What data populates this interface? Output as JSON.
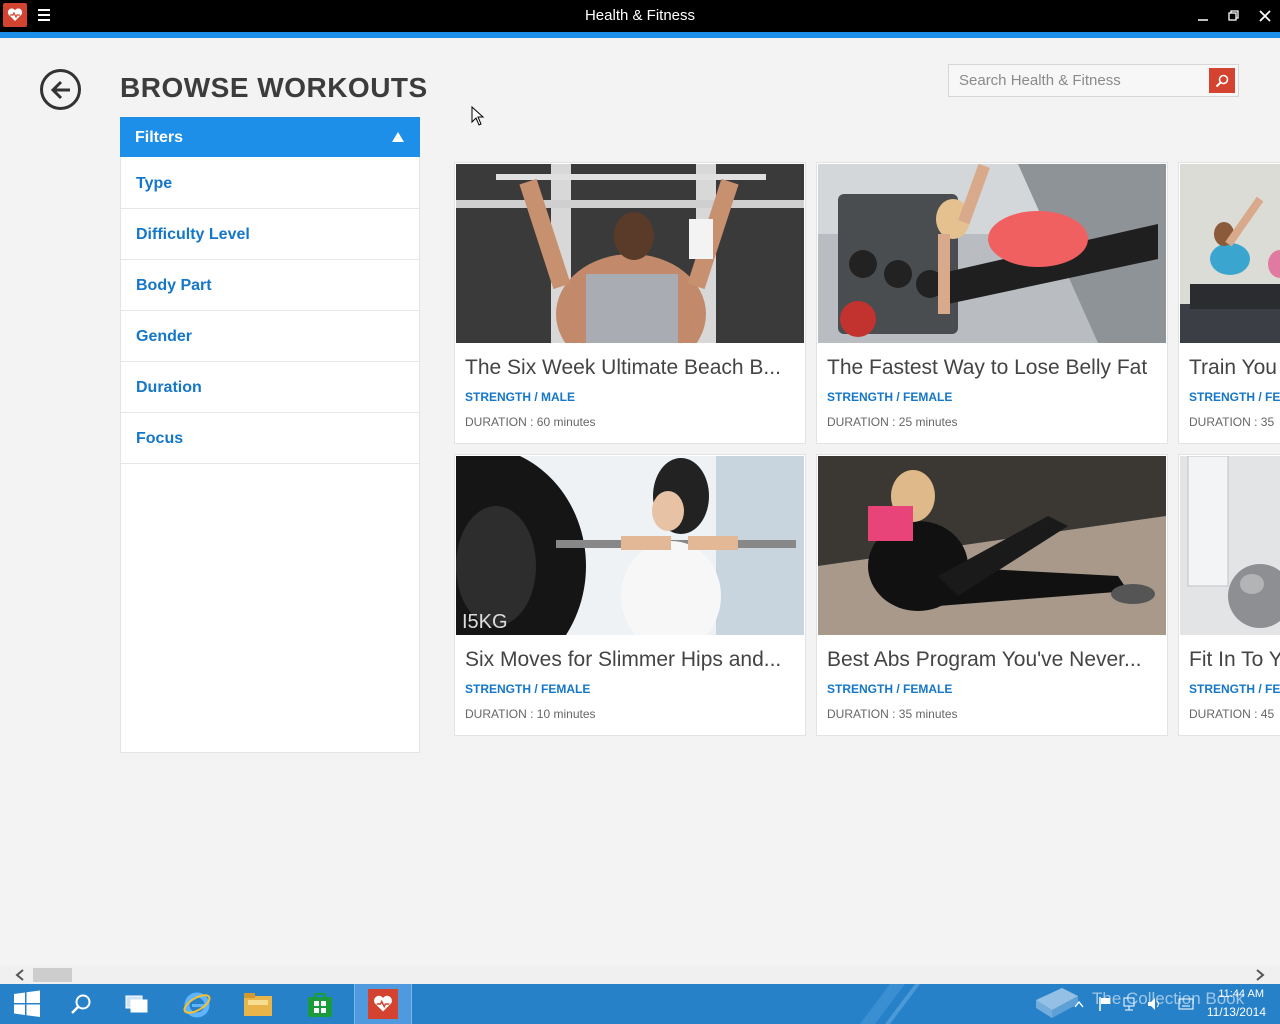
{
  "window": {
    "title": "Health & Fitness"
  },
  "header": {
    "title": "BROWSE WORKOUTS",
    "search_placeholder": "Search Health & Fitness"
  },
  "filters": {
    "heading": "Filters",
    "items": [
      "Type",
      "Difficulty Level",
      "Body Part",
      "Gender",
      "Duration",
      "Focus"
    ]
  },
  "workouts": [
    {
      "title": "The Six Week Ultimate Beach B...",
      "category": "STRENGTH / MALE",
      "duration_label": "DURATION :",
      "duration": "60 minutes"
    },
    {
      "title": "The Fastest Way to Lose Belly Fat",
      "category": "STRENGTH / FEMALE",
      "duration_label": "DURATION :",
      "duration": "25 minutes"
    },
    {
      "title": "Train You",
      "category": "STRENGTH / FE",
      "duration_label": "DURATION :",
      "duration": "35"
    },
    {
      "title": "Six Moves for Slimmer Hips and...",
      "category": "STRENGTH / FEMALE",
      "duration_label": "DURATION :",
      "duration": "10 minutes"
    },
    {
      "title": "Best Abs Program You've Never...",
      "category": "STRENGTH / FEMALE",
      "duration_label": "DURATION :",
      "duration": "35 minutes"
    },
    {
      "title": "Fit In To Y",
      "category": "STRENGTH / FE",
      "duration_label": "DURATION :",
      "duration": "45"
    }
  ],
  "taskbar": {
    "watermark": "The Collection Book",
    "time": "11:44 AM",
    "date": "11/13/2014"
  },
  "colors": {
    "accent": "#1e8fe8",
    "brand": "#d4432f",
    "link": "#1577c9",
    "taskbar": "#2781c9"
  }
}
